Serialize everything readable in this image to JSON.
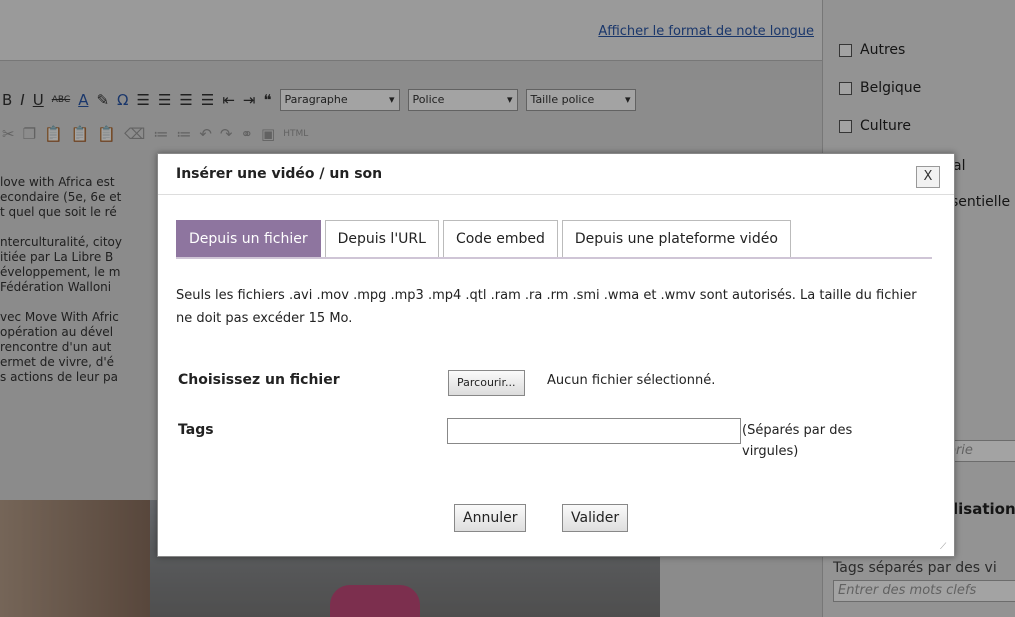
{
  "background": {
    "editor_link": "Afficher le format de note longue",
    "toolbar": {
      "format_select": "Paragraphe",
      "font_select": "Police",
      "size_select": "Taille police",
      "html_button": "HTML"
    },
    "text_lines": [
      "love with Africa est",
      "econdaire (5e, 6e et",
      "t quel que soit le ré",
      "nterculturalité, citoy",
      "itiée par La Libre B",
      "éveloppement, le m",
      "Fédération Walloni",
      "vec Move With Afric",
      "opération au dével",
      "rencontre d'un aut",
      "ermet de vivre, d'é",
      "s actions de leur pa"
    ],
    "sidebar": {
      "categories": [
        "Autres",
        "Belgique",
        "Culture"
      ],
      "fragment_al": "al",
      "fragment_sentielle": "sentielle",
      "category_input_placeholder": "orie",
      "heading_fragment": "lisation",
      "tags_label_fragment": "Tags séparés par des vi",
      "tags_input_placeholder": "Entrer des mots clefs"
    }
  },
  "dialog": {
    "title": "Insérer une vidéo / un son",
    "close_label": "X",
    "tabs": [
      {
        "label": "Depuis un fichier",
        "active": true
      },
      {
        "label": "Depuis l'URL",
        "active": false
      },
      {
        "label": "Code embed",
        "active": false
      },
      {
        "label": "Depuis une plateforme vidéo",
        "active": false
      }
    ],
    "description": "Seuls les fichiers .avi .mov .mpg .mp3 .mp4 .qtl .ram .ra .rm .smi .wma et .wmv sont autorisés. La taille du fichier ne doit pas excéder 15 Mo.",
    "file_label": "Choisissez un fichier",
    "browse_label": "Parcourir...",
    "no_file_text": "Aucun fichier sélectionné.",
    "tags_label": "Tags",
    "tags_value": "",
    "tags_hint": "(Séparés par des virgules)",
    "cancel_label": "Annuler",
    "submit_label": "Valider"
  },
  "colors": {
    "active_tab": "#8e759f",
    "overlay": "rgba(0,0,0,0.36)"
  }
}
